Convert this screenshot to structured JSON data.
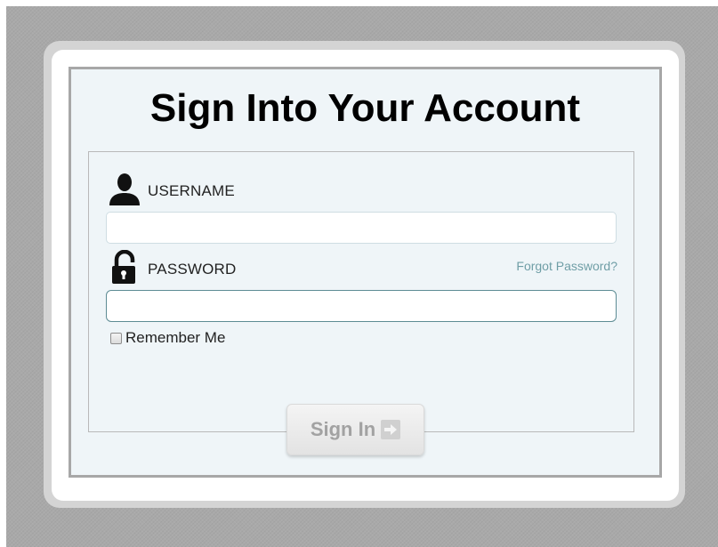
{
  "page": {
    "title": "Sign Into Your Account"
  },
  "username": {
    "label": "USERNAME",
    "value": "",
    "placeholder": "",
    "icon": "user-silhouette-icon"
  },
  "password": {
    "label": "PASSWORD",
    "value": "",
    "placeholder": "",
    "icon": "padlock-icon",
    "forgot_link": "Forgot Password?"
  },
  "remember": {
    "label": "Remember Me",
    "checked": false
  },
  "submit": {
    "label": "Sign In",
    "icon": "arrow-right-icon"
  },
  "colors": {
    "background": "#a9a9a9",
    "panel": "#eff5f8",
    "link": "#6f9ea6",
    "focus_border": "#5d8c94",
    "button_text": "#a2a2a2"
  }
}
